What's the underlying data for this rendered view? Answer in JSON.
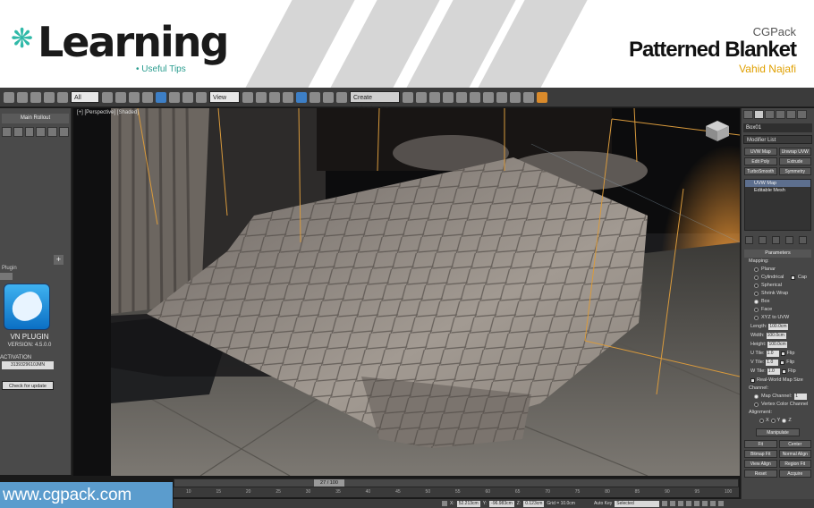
{
  "banner": {
    "logo": "Learning",
    "tagline": "Useful Tips",
    "brand": "CGPack",
    "title": "Patterned Blanket",
    "author": "Vahid Najafi",
    "accent_color": "#2fb9a8",
    "author_color": "#e0a000"
  },
  "toolbar": {
    "filter_value": "All",
    "view_value": "View",
    "selection_set_value": "Create Selection Se"
  },
  "left_panel": {
    "rollout_title": "Main Rollout",
    "plugin_label": "Plugin",
    "plugin_name": "VN PLUGIN",
    "plugin_version": "VERSION: 4.5.0.0",
    "activation_label": "ACTIVATION",
    "activation_code": "3139329610JMN",
    "check_update": "Check for update"
  },
  "viewport": {
    "label": "[+] [Perspective] [Shaded]"
  },
  "command_panel": {
    "object_name": "Box01",
    "modifier_list": "Modifier List",
    "buttons": [
      "UVW Map",
      "Unwrap UVW",
      "Edit Poly",
      "Extrude",
      "TurboSmooth",
      "Symmetry"
    ],
    "stack": [
      "UVW Map",
      "Editable Mesh"
    ],
    "parameters_title": "Parameters",
    "mapping_label": "Mapping:",
    "mapping_options": [
      "Planar",
      "Cylindrical",
      "Spherical",
      "Shrink Wrap",
      "Box",
      "Face",
      "XYZ to UVW"
    ],
    "mapping_selected": "Box",
    "cap_label": "Cap",
    "length_label": "Length:",
    "length_value": "100.0cm",
    "width_label": "Width:",
    "width_value": "100.0cm",
    "height_label": "Height:",
    "height_value": "100.0cm",
    "u_tile_label": "U Tile:",
    "u_tile_value": "1.0",
    "v_tile_label": "V Tile:",
    "v_tile_value": "1.0",
    "w_tile_label": "W Tile:",
    "w_tile_value": "1.0",
    "flip_label": "Flip",
    "real_world": "Real-World Map Size",
    "channel_label": "Channel:",
    "map_channel_label": "Map Channel:",
    "map_channel_value": "1",
    "vertex_color_channel": "Vertex Color Channel",
    "alignment_label": "Alignment:",
    "align_x": "X",
    "align_y": "Y",
    "align_z": "Z",
    "manipulate": "Manipulate",
    "fit": "Fit",
    "center": "Center",
    "bitmap_fit": "Bitmap Fit",
    "normal_align": "Normal Align",
    "view_align": "View Align",
    "region_fit": "Region Fit",
    "reset": "Reset",
    "acquire": "Acquire"
  },
  "timeline": {
    "current_frame": "27 / 100",
    "ticks": [
      "10",
      "15",
      "20",
      "25",
      "30",
      "35",
      "40",
      "45",
      "50",
      "55",
      "60",
      "65",
      "70",
      "75",
      "80",
      "85",
      "90",
      "95",
      "100"
    ]
  },
  "status": {
    "x_label": "X:",
    "x_value": "52.213cm",
    "y_label": "Y:",
    "y_value": "-96.983cm",
    "z_label": "Z:",
    "z_value": "0.123cm",
    "grid_label": "Grid = 10.0cm",
    "auto_key": "Auto Key",
    "key_value": "Selected"
  },
  "watermark": "www.cgpack.com"
}
